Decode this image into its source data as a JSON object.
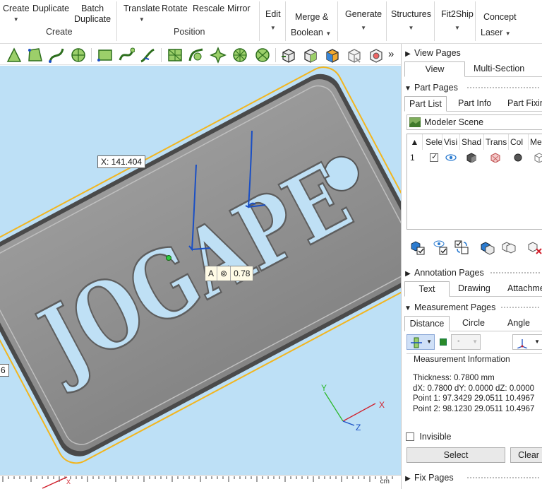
{
  "ribbon": {
    "create": "Create",
    "duplicate": "Duplicate",
    "batch_duplicate_1": "Batch",
    "batch_duplicate_2": "Duplicate",
    "group_create": "Create",
    "translate": "Translate",
    "rotate": "Rotate",
    "rescale": "Rescale",
    "mirror": "Mirror",
    "group_position": "Position",
    "edit": "Edit",
    "merge_1": "Merge &",
    "merge_2": "Boolean",
    "generate": "Generate",
    "structures": "Structures",
    "fit2ship": "Fit2Ship",
    "concept_1": "Concept",
    "concept_2": "Laser"
  },
  "toolbar": {
    "overflow": "»"
  },
  "viewport": {
    "coord_x": "X: 141.404",
    "partial_value": "6",
    "edit_mode": "A",
    "edit_symbol": "⊚",
    "edit_value": "0.78",
    "engraved_text": "JOGAPE",
    "axis_x": "X",
    "axis_y": "Y",
    "axis_z": "Z",
    "ruler_end": "cm"
  },
  "panel": {
    "view_pages": "View Pages",
    "tab_view": "View",
    "tab_multisection": "Multi-Section",
    "part_pages": "Part Pages",
    "tab_partlist": "Part List",
    "tab_partinfo": "Part Info",
    "tab_partfixing": "Part Fixing",
    "scene_name": "Modeler Scene",
    "columns": [
      "Sele",
      "Visi",
      "Shad",
      "Trans",
      "Col",
      "Me"
    ],
    "row_index": "1",
    "annotation_pages": "Annotation Pages",
    "tab_text": "Text",
    "tab_drawing": "Drawing",
    "tab_attachment": "Attachment",
    "measurement_pages": "Measurement Pages",
    "tab_distance": "Distance",
    "tab_circle": "Circle",
    "tab_angle": "Angle",
    "info_title": "Measurement Information",
    "thickness": "Thickness: 0.7800 mm",
    "deltas": "dX: 0.7800 dY: 0.0000 dZ: 0.0000",
    "point1": "Point 1: 97.3429 29.0511 10.4967",
    "point2": "Point 2: 98.1230 29.0511 10.4967",
    "invisible": "Invisible",
    "select_btn": "Select",
    "clear_btn": "Clear",
    "fix_pages": "Fix Pages"
  },
  "colors": {
    "viewport_bg": "#bde0f6",
    "part_gray": "#8f8f8f",
    "accent_blue": "#1a4fc4",
    "edge_yellow": "#f2b51e"
  }
}
